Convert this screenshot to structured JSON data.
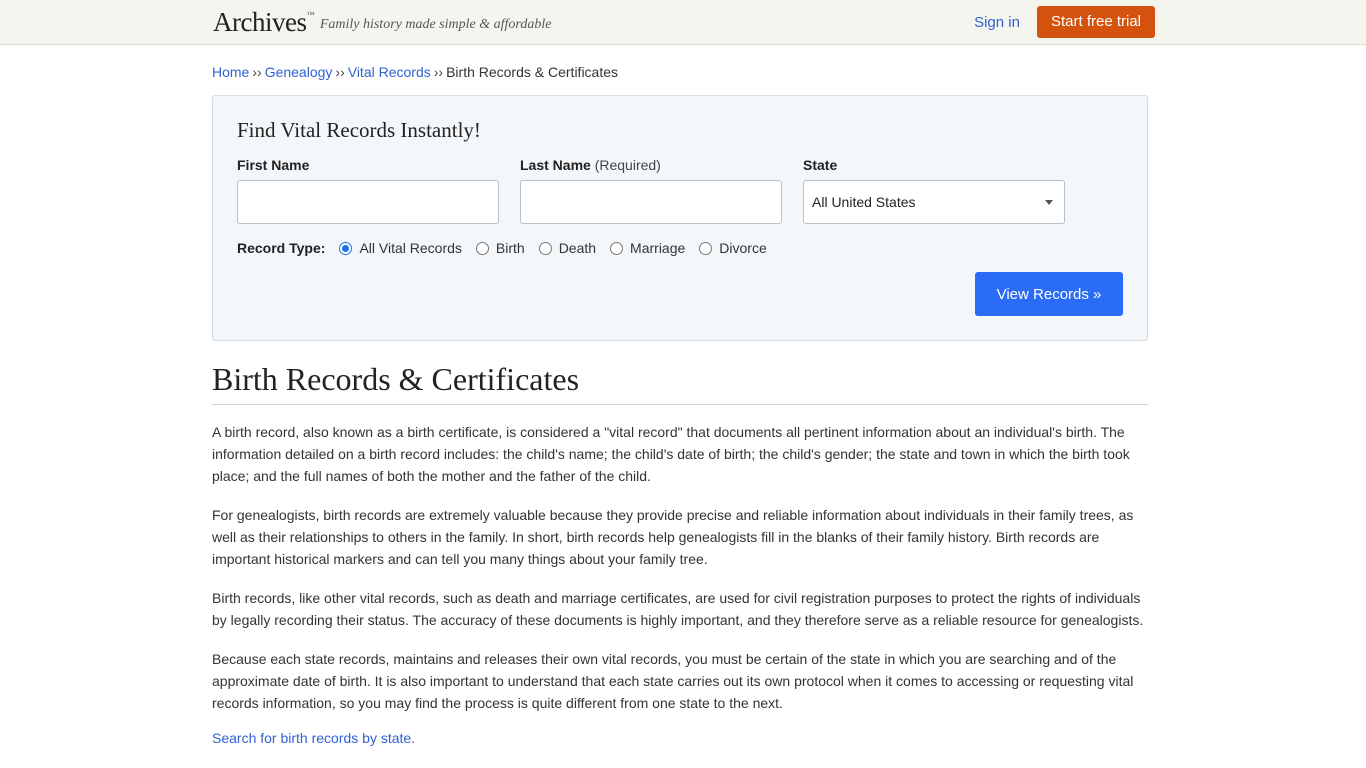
{
  "header": {
    "logo": "Archives",
    "logo_tm": "™",
    "tagline": "Family history made simple & affordable",
    "signin_label": "Sign in",
    "trial_label": "Start free trial"
  },
  "breadcrumb": {
    "items": [
      "Home",
      "Genealogy",
      "Vital Records"
    ],
    "separator": "››",
    "current": "Birth Records & Certificates"
  },
  "search": {
    "title": "Find Vital Records Instantly!",
    "first_name_label": "First Name",
    "last_name_label": "Last Name",
    "last_name_required": "(Required)",
    "state_label": "State",
    "state_value": "All United States",
    "record_type_label": "Record Type:",
    "record_types": [
      "All Vital Records",
      "Birth",
      "Death",
      "Marriage",
      "Divorce"
    ],
    "selected_record_type": "All Vital Records",
    "submit_label": "View Records »"
  },
  "article": {
    "title": "Birth Records & Certificates",
    "paragraphs": [
      "A birth record, also known as a birth certificate, is considered a \"vital record\" that documents all pertinent information about an individual's birth. The information detailed on a birth record includes: the child's name; the child's date of birth; the child's gender; the state and town in which the birth took place; and the full names of both the mother and the father of the child.",
      "For genealogists, birth records are extremely valuable because they provide precise and reliable information about individuals in their family trees, as well as their relationships to others in the family. In short, birth records help genealogists fill in the blanks of their family history. Birth records are important historical markers and can tell you many things about your family tree.",
      "Birth records, like other vital records, such as death and marriage certificates, are used for civil registration purposes to protect the rights of individuals by legally recording their status. The accuracy of these documents is highly important, and they therefore serve as a reliable resource for genealogists.",
      "Because each state records, maintains and releases their own vital records, you must be certain of the state in which you are searching and of the approximate date of birth. It is also important to understand that each state carries out its own protocol when it comes to accessing or requesting vital records information, so you may find the process is quite different from one state to the next."
    ],
    "state_link": "Search for birth records by state."
  },
  "colors": {
    "link": "#2f63d1",
    "trial_button": "#d2520e",
    "submit_button": "#2a6cf5"
  }
}
